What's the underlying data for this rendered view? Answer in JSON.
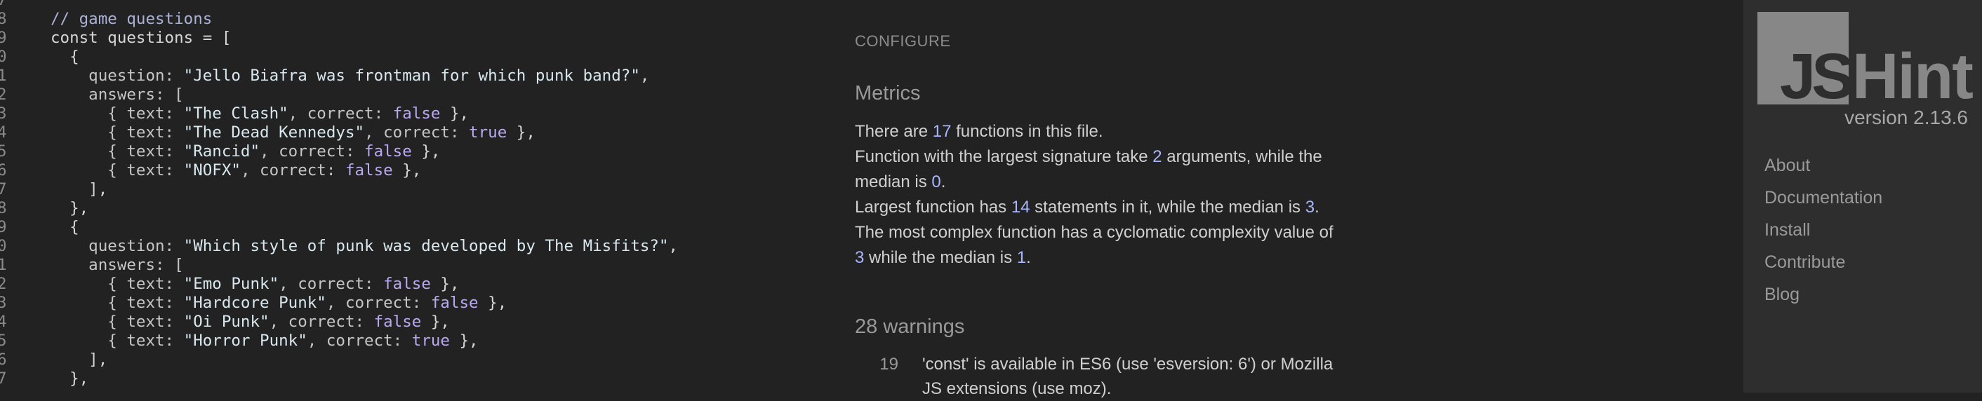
{
  "editor": {
    "lines": [
      {
        "n": "7",
        "tokens": []
      },
      {
        "n": "8",
        "tokens": [
          {
            "t": "// game questions",
            "c": "tok-comment"
          }
        ]
      },
      {
        "n": "9",
        "tokens": [
          {
            "t": "const questions = [",
            "c": "tok-key"
          }
        ]
      },
      {
        "n": "0",
        "tokens": [
          {
            "t": "  {",
            "c": "tok-key"
          }
        ]
      },
      {
        "n": "1",
        "tokens": [
          {
            "t": "    question: ",
            "c": "tok-prop"
          },
          {
            "t": "\"Jello Biafra was frontman for which punk band?\"",
            "c": "tok-str"
          },
          {
            "t": ",",
            "c": "tok-key"
          }
        ]
      },
      {
        "n": "2",
        "tokens": [
          {
            "t": "    answers: [",
            "c": "tok-prop"
          }
        ]
      },
      {
        "n": "3",
        "tokens": [
          {
            "t": "      { text: ",
            "c": "tok-prop"
          },
          {
            "t": "\"The Clash\"",
            "c": "tok-str"
          },
          {
            "t": ", correct: ",
            "c": "tok-prop"
          },
          {
            "t": "false",
            "c": "tok-bool"
          },
          {
            "t": " },",
            "c": "tok-key"
          }
        ]
      },
      {
        "n": "4",
        "tokens": [
          {
            "t": "      { text: ",
            "c": "tok-prop"
          },
          {
            "t": "\"The Dead Kennedys\"",
            "c": "tok-str"
          },
          {
            "t": ", correct: ",
            "c": "tok-prop"
          },
          {
            "t": "true",
            "c": "tok-bool"
          },
          {
            "t": " },",
            "c": "tok-key"
          }
        ]
      },
      {
        "n": "5",
        "tokens": [
          {
            "t": "      { text: ",
            "c": "tok-prop"
          },
          {
            "t": "\"Rancid\"",
            "c": "tok-str"
          },
          {
            "t": ", correct: ",
            "c": "tok-prop"
          },
          {
            "t": "false",
            "c": "tok-bool"
          },
          {
            "t": " },",
            "c": "tok-key"
          }
        ]
      },
      {
        "n": "6",
        "tokens": [
          {
            "t": "      { text: ",
            "c": "tok-prop"
          },
          {
            "t": "\"NOFX\"",
            "c": "tok-str"
          },
          {
            "t": ", correct: ",
            "c": "tok-prop"
          },
          {
            "t": "false",
            "c": "tok-bool"
          },
          {
            "t": " },",
            "c": "tok-key"
          }
        ]
      },
      {
        "n": "7",
        "tokens": [
          {
            "t": "    ],",
            "c": "tok-key"
          }
        ]
      },
      {
        "n": "8",
        "tokens": [
          {
            "t": "  },",
            "c": "tok-key"
          }
        ]
      },
      {
        "n": "9",
        "tokens": [
          {
            "t": "  {",
            "c": "tok-key"
          }
        ]
      },
      {
        "n": "0",
        "tokens": [
          {
            "t": "    question: ",
            "c": "tok-prop"
          },
          {
            "t": "\"Which style of punk was developed by The Misfits?\"",
            "c": "tok-str"
          },
          {
            "t": ",",
            "c": "tok-key"
          }
        ]
      },
      {
        "n": "1",
        "tokens": [
          {
            "t": "    answers: [",
            "c": "tok-prop"
          }
        ]
      },
      {
        "n": "2",
        "tokens": [
          {
            "t": "      { text: ",
            "c": "tok-prop"
          },
          {
            "t": "\"Emo Punk\"",
            "c": "tok-str"
          },
          {
            "t": ", correct: ",
            "c": "tok-prop"
          },
          {
            "t": "false",
            "c": "tok-bool"
          },
          {
            "t": " },",
            "c": "tok-key"
          }
        ]
      },
      {
        "n": "3",
        "tokens": [
          {
            "t": "      { text: ",
            "c": "tok-prop"
          },
          {
            "t": "\"Hardcore Punk\"",
            "c": "tok-str"
          },
          {
            "t": ", correct: ",
            "c": "tok-prop"
          },
          {
            "t": "false",
            "c": "tok-bool"
          },
          {
            "t": " },",
            "c": "tok-key"
          }
        ]
      },
      {
        "n": "4",
        "tokens": [
          {
            "t": "      { text: ",
            "c": "tok-prop"
          },
          {
            "t": "\"Oi Punk\"",
            "c": "tok-str"
          },
          {
            "t": ", correct: ",
            "c": "tok-prop"
          },
          {
            "t": "false",
            "c": "tok-bool"
          },
          {
            "t": " },",
            "c": "tok-key"
          }
        ]
      },
      {
        "n": "5",
        "tokens": [
          {
            "t": "      { text: ",
            "c": "tok-prop"
          },
          {
            "t": "\"Horror Punk\"",
            "c": "tok-str"
          },
          {
            "t": ", correct: ",
            "c": "tok-prop"
          },
          {
            "t": "true",
            "c": "tok-bool"
          },
          {
            "t": " },",
            "c": "tok-key"
          }
        ]
      },
      {
        "n": "6",
        "tokens": [
          {
            "t": "    ],",
            "c": "tok-key"
          }
        ]
      },
      {
        "n": "7",
        "tokens": [
          {
            "t": "  },",
            "c": "tok-key"
          }
        ]
      }
    ]
  },
  "report": {
    "configure_label": "CONFIGURE",
    "metrics_title": "Metrics",
    "metrics": {
      "functions": {
        "pre": "There are ",
        "num": "17",
        "post": " functions in this file."
      },
      "signature": {
        "pre": "Function with the largest signature take ",
        "num": "2",
        "mid": " arguments, while the median is ",
        "num2": "0",
        "post": "."
      },
      "statements": {
        "pre": "Largest function has ",
        "num": "14",
        "mid": " statements in it, while the median is ",
        "num2": "3",
        "post": "."
      },
      "complexity": {
        "pre": "The most complex function has a cyclomatic complexity value of ",
        "num": "3",
        "mid": " while the median is ",
        "num2": "1",
        "post": "."
      }
    },
    "warnings_title": "28 warnings",
    "warnings": [
      {
        "line": "19",
        "message": "'const' is available in ES6 (use 'esversion: 6') or Mozilla JS extensions (use moz)."
      }
    ]
  },
  "sidebar": {
    "logo_js": "JS",
    "logo_hint": "Hint",
    "version": "version 2.13.6",
    "nav": [
      "About",
      "Documentation",
      "Install",
      "Contribute",
      "Blog"
    ]
  }
}
